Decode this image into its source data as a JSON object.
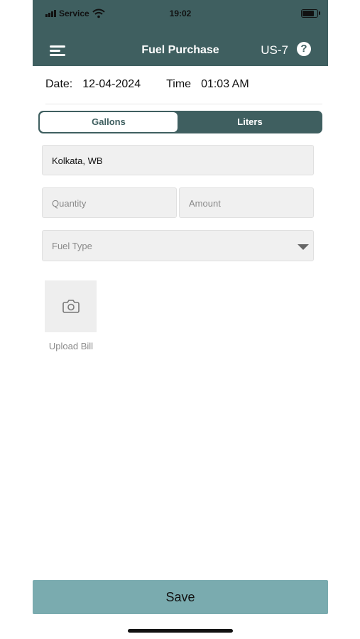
{
  "status_bar": {
    "carrier": "Service",
    "time": "19:02"
  },
  "header": {
    "title": "Fuel Purchase",
    "unit_id": "US-7",
    "help_symbol": "?"
  },
  "datetime": {
    "date_label": "Date:",
    "date_value": "12-04-2024",
    "time_label": "Time",
    "time_value": "01:03 AM"
  },
  "unit_toggle": {
    "options": [
      "Gallons",
      "Liters"
    ],
    "selected": "Gallons"
  },
  "form": {
    "location_value": "Kolkata, WB",
    "quantity_placeholder": "Quantity",
    "amount_placeholder": "Amount",
    "fuel_type_placeholder": "Fuel Type"
  },
  "upload": {
    "label": "Upload Bill",
    "icon": "camera-icon"
  },
  "actions": {
    "save_label": "Save"
  },
  "colors": {
    "header_bg": "#3f5f60",
    "save_bg": "#7aabaf"
  }
}
